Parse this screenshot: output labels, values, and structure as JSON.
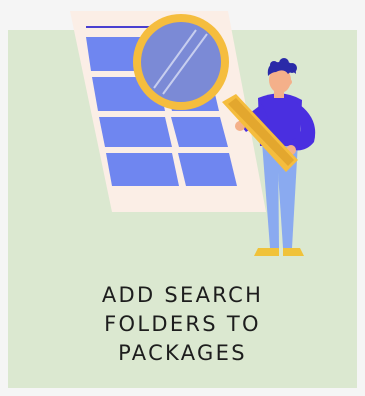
{
  "card": {
    "title_lines": [
      "ADD SEARCH",
      "FOLDERS TO",
      "PACKAGES"
    ]
  },
  "illustration": {
    "subject": "person-with-magnifying-glass-inspecting-document",
    "icons": [
      "document-icon",
      "magnifying-glass-icon",
      "person-icon"
    ]
  },
  "colors": {
    "page_background": "#f5f5f5",
    "panel_background": "#dbe8d0",
    "document_paper": "#fbeee6",
    "document_cells": "#6f86f0",
    "magnifier_frame": "#f5bd3e",
    "lens_glass": "#7b8ad6",
    "shirt": "#4a2fe0",
    "pants": "#8aaaf0",
    "skin": "#f4b08a",
    "hair": "#2a2aa8",
    "shoes": "#f0c23a",
    "text": "#1d1d1d"
  }
}
